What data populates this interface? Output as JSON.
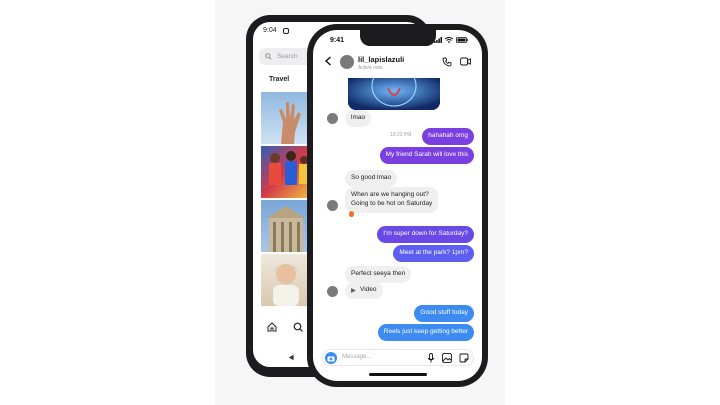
{
  "colors": {
    "purple": "#7a3fe0",
    "violet": "#6a4ae6",
    "indigo": "#5b5ef0",
    "blue": "#3d8bf0",
    "instagram_blue": "#3a8de8"
  },
  "back_phone": {
    "time": "9:04",
    "search_placeholder": "Search",
    "tab_label": "Travel",
    "nav_icons": [
      "home-icon",
      "search-icon"
    ],
    "system_icons": [
      "back-triangle-icon"
    ]
  },
  "front_phone": {
    "time": "9:41",
    "status_icons": [
      "signal-icon",
      "wifi-icon",
      "battery-icon"
    ],
    "header": {
      "username": "lil_lapislazuli",
      "subtitle": "Active now",
      "icons": [
        "back-arrow-icon",
        "phone-icon",
        "video-camera-icon"
      ]
    },
    "messages": [
      {
        "id": "m1",
        "direction": "in",
        "text": "lmao",
        "color": "gray"
      },
      {
        "id": "ts",
        "direction": "meta",
        "text": "10:23 PM"
      },
      {
        "id": "m2",
        "direction": "out",
        "text": "hahahah omg",
        "color": "purple"
      },
      {
        "id": "m3",
        "direction": "out",
        "text": "My friend Sarah will love this",
        "color": "purple"
      },
      {
        "id": "m4",
        "direction": "in",
        "text": "So good lmao",
        "color": "gray"
      },
      {
        "id": "m5",
        "direction": "in",
        "text": "When are we hanging out?\nGoing to be hot on Saturday",
        "color": "gray"
      },
      {
        "id": "m6",
        "direction": "out",
        "text": "I'm super down for Saturday?",
        "color": "violet"
      },
      {
        "id": "m7",
        "direction": "out",
        "text": "Meet at the park? 1pm?",
        "color": "violet"
      },
      {
        "id": "m8",
        "direction": "in",
        "text": "Perfect seeya then",
        "color": "gray"
      },
      {
        "id": "m9",
        "direction": "in",
        "text": "Video",
        "color": "gray"
      },
      {
        "id": "m10",
        "direction": "out",
        "text": "Good stuff today",
        "color": "blue"
      },
      {
        "id": "m11",
        "direction": "out",
        "text": "Reels just keep getting better",
        "color": "blue"
      }
    ],
    "composer": {
      "placeholder": "Message...",
      "icons": [
        "camera-icon",
        "microphone-icon",
        "gallery-icon",
        "sticker-icon"
      ]
    }
  }
}
